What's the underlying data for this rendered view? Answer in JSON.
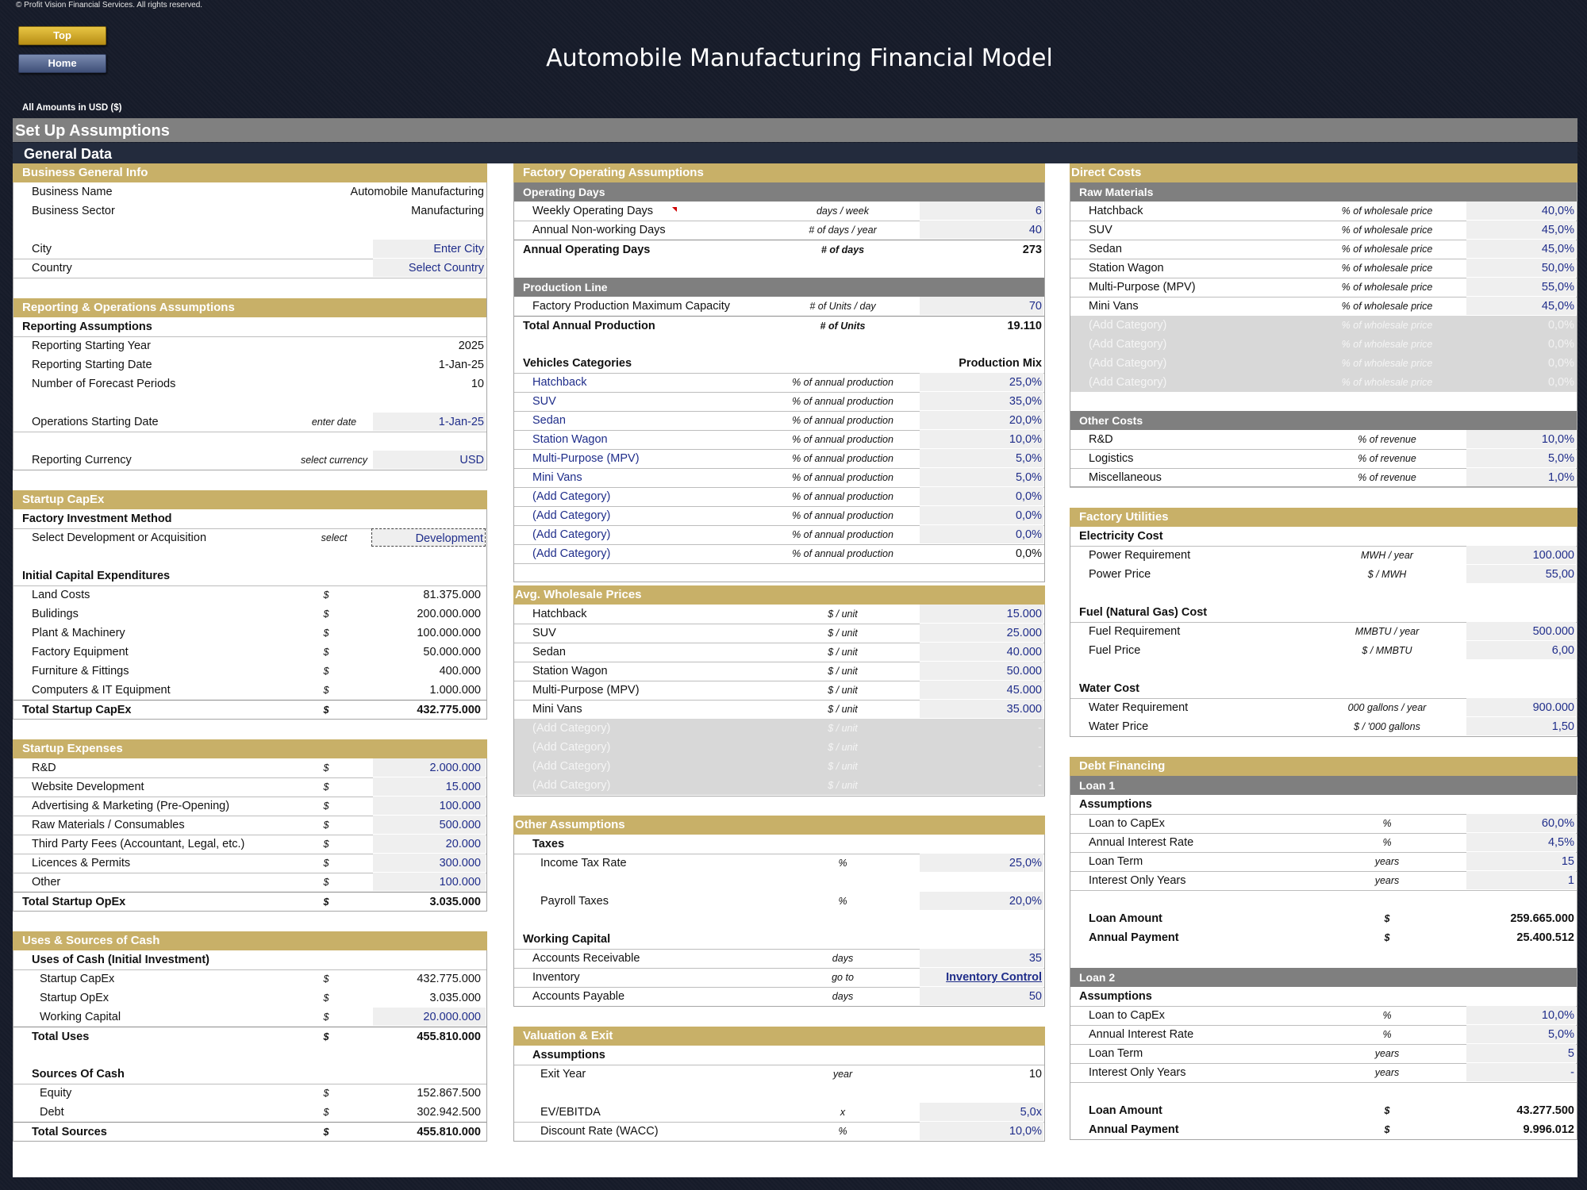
{
  "copyright": "© Profit Vision Financial Services. All rights reserved.",
  "nav": {
    "top": "Top",
    "home": "Home"
  },
  "title": "Automobile Manufacturing Financial Model",
  "amounts_label": "All Amounts in  USD ($)",
  "setup_title": "Set Up Assumptions",
  "general_title": "General Data",
  "colors": {
    "gold": "#c8b068",
    "grey_header": "#7f7f7f",
    "navy": "#232b3d",
    "input_text": "#1f2d8a"
  },
  "col1": {
    "bgi": {
      "title": "Business General Info",
      "business_name_label": "Business Name",
      "business_name": "Automobile Manufacturing",
      "sector_label": "Business Sector",
      "sector": "Manufacturing",
      "city_label": "City",
      "city": "Enter City",
      "country_label": "Country",
      "country": "Select Country"
    },
    "reporting": {
      "title": "Reporting & Operations Assumptions",
      "sub": "Reporting Assumptions",
      "start_year_label": "Reporting Starting Year",
      "start_year": "2025",
      "start_date_label": "Reporting Starting Date",
      "start_date": "1-Jan-25",
      "periods_label": "Number of Forecast Periods",
      "periods": "10",
      "ops_label": "Operations Starting Date",
      "ops_unit": "enter date",
      "ops_date": "1-Jan-25",
      "currency_label": "Reporting Currency",
      "currency_unit": "select currency",
      "currency": "USD"
    },
    "capex": {
      "title": "Startup CapEx",
      "method_sub": "Factory Investment Method",
      "select_label": "Select Development or Acquisition",
      "select_unit": "select",
      "select_value": "Development",
      "initial_sub": "Initial Capital Expenditures",
      "items": [
        {
          "label": "Land Costs",
          "unit": "$",
          "value": "81.375.000"
        },
        {
          "label": "Bulidings",
          "unit": "$",
          "value": "200.000.000"
        },
        {
          "label": "Plant & Machinery",
          "unit": "$",
          "value": "100.000.000"
        },
        {
          "label": "Factory Equipment",
          "unit": "$",
          "value": "50.000.000"
        },
        {
          "label": "Furniture & Fittings",
          "unit": "$",
          "value": "400.000"
        },
        {
          "label": "Computers & IT Equipment",
          "unit": "$",
          "value": "1.000.000"
        }
      ],
      "total_label": "Total Startup CapEx",
      "total_unit": "$",
      "total": "432.775.000"
    },
    "expenses": {
      "title": "Startup Expenses",
      "items": [
        {
          "label": "R&D",
          "unit": "$",
          "value": "2.000.000"
        },
        {
          "label": "Website Development",
          "unit": "$",
          "value": "15.000"
        },
        {
          "label": "Advertising & Marketing (Pre-Opening)",
          "unit": "$",
          "value": "100.000"
        },
        {
          "label": "Raw Materials / Consumables",
          "unit": "$",
          "value": "500.000"
        },
        {
          "label": "Third Party Fees (Accountant, Legal, etc.)",
          "unit": "$",
          "value": "20.000"
        },
        {
          "label": "Licences & Permits",
          "unit": "$",
          "value": "300.000"
        },
        {
          "label": "Other",
          "unit": "$",
          "value": "100.000"
        }
      ],
      "total_label": "Total Startup OpEx",
      "total_unit": "$",
      "total": "3.035.000"
    },
    "uses": {
      "title": "Uses & Sources of Cash",
      "uses_sub": "Uses of Cash (Initial Investment)",
      "uses_items": [
        {
          "label": "Startup CapEx",
          "unit": "$",
          "value": "432.775.000"
        },
        {
          "label": "Startup OpEx",
          "unit": "$",
          "value": "3.035.000"
        },
        {
          "label": "Working Capital",
          "unit": "$",
          "value": "20.000.000"
        }
      ],
      "total_uses_label": "Total Uses",
      "total_uses_unit": "$",
      "total_uses": "455.810.000",
      "sources_sub": "Sources Of Cash",
      "sources_items": [
        {
          "label": "Equity",
          "unit": "$",
          "value": "152.867.500"
        },
        {
          "label": "Debt",
          "unit": "$",
          "value": "302.942.500"
        }
      ],
      "total_sources_label": "Total Sources",
      "total_sources_unit": "$",
      "total_sources": "455.810.000"
    }
  },
  "col2": {
    "factory": {
      "title": "Factory Operating Assumptions",
      "opdays_sub": "Operating Days",
      "weekly_label": "Weekly Operating Days",
      "weekly_unit": "days / week",
      "weekly": "6",
      "nonwork_label": "Annual Non-working Days",
      "nonwork_unit": "# of days / year",
      "nonwork": "40",
      "annual_label": "Annual Operating Days",
      "annual_unit": "# of days",
      "annual": "273",
      "prod_sub": "Production Line",
      "cap_label": "Factory Production Maximum Capacity",
      "cap_unit": "# of Units / day",
      "cap": "70",
      "total_label": "Total Annual Production",
      "total_unit": "# of Units",
      "total": "19.110",
      "veh_label": "Vehicles Categories",
      "mix_label": "Production Mix",
      "veh": [
        {
          "label": "Hatchback",
          "unit": "% of annual production",
          "value": "25,0%"
        },
        {
          "label": "SUV",
          "unit": "% of annual production",
          "value": "35,0%"
        },
        {
          "label": "Sedan",
          "unit": "% of annual production",
          "value": "20,0%"
        },
        {
          "label": "Station Wagon",
          "unit": "% of annual production",
          "value": "10,0%"
        },
        {
          "label": "Multi-Purpose (MPV)",
          "unit": "% of annual production",
          "value": "5,0%"
        },
        {
          "label": "Mini Vans",
          "unit": "% of annual production",
          "value": "5,0%"
        },
        {
          "label": "(Add Category)",
          "unit": "% of annual production",
          "value": "0,0%"
        },
        {
          "label": "(Add Category)",
          "unit": "% of annual production",
          "value": "0,0%"
        },
        {
          "label": "(Add Category)",
          "unit": "% of annual production",
          "value": "0,0%"
        },
        {
          "label": "(Add Category)",
          "unit": "% of annual production",
          "value": "0,0%"
        }
      ]
    },
    "prices": {
      "title": "Avg. Wholesale Prices",
      "items": [
        {
          "label": "Hatchback",
          "unit": "$ / unit",
          "value": "15.000"
        },
        {
          "label": "SUV",
          "unit": "$ / unit",
          "value": "25.000"
        },
        {
          "label": "Sedan",
          "unit": "$ / unit",
          "value": "40.000"
        },
        {
          "label": "Station Wagon",
          "unit": "$ / unit",
          "value": "50.000"
        },
        {
          "label": "Multi-Purpose (MPV)",
          "unit": "$ / unit",
          "value": "45.000"
        },
        {
          "label": "Mini Vans",
          "unit": "$ / unit",
          "value": "35.000"
        }
      ],
      "disabled": [
        {
          "label": "(Add Category)",
          "unit": "$ / unit",
          "value": "-"
        },
        {
          "label": "(Add Category)",
          "unit": "$ / unit",
          "value": "-"
        },
        {
          "label": "(Add Category)",
          "unit": "$ / unit",
          "value": "-"
        },
        {
          "label": "(Add Category)",
          "unit": "$ / unit",
          "value": "-"
        }
      ]
    },
    "other": {
      "title": "Other Assumptions",
      "taxes_sub": "Taxes",
      "income_label": "Income Tax Rate",
      "income_unit": "%",
      "income": "25,0%",
      "payroll_label": "Payroll Taxes",
      "payroll_unit": "%",
      "payroll": "20,0%",
      "wc_sub": "Working Capital",
      "ar_label": "Accounts Receivable",
      "ar_unit": "days",
      "ar": "35",
      "inv_label": "Inventory",
      "inv_unit": "go to",
      "inv": "Inventory Control",
      "ap_label": "Accounts Payable",
      "ap_unit": "days",
      "ap": "50"
    },
    "valuation": {
      "title": "Valuation & Exit",
      "sub": "Assumptions",
      "exit_label": "Exit Year",
      "exit_unit": "year",
      "exit": "10",
      "ev_label": "EV/EBITDA",
      "ev_unit": "x",
      "ev": "5,0x",
      "wacc_label": "Discount Rate (WACC)",
      "wacc_unit": "%",
      "wacc": "10,0%"
    }
  },
  "col3": {
    "direct": {
      "title": "Direct Costs",
      "raw_sub": "Raw Materials",
      "raw": [
        {
          "label": "Hatchback",
          "unit": "% of wholesale price",
          "value": "40,0%"
        },
        {
          "label": "SUV",
          "unit": "% of wholesale price",
          "value": "45,0%"
        },
        {
          "label": "Sedan",
          "unit": "% of wholesale price",
          "value": "45,0%"
        },
        {
          "label": "Station Wagon",
          "unit": "% of wholesale price",
          "value": "50,0%"
        },
        {
          "label": "Multi-Purpose (MPV)",
          "unit": "% of wholesale price",
          "value": "55,0%"
        },
        {
          "label": "Mini Vans",
          "unit": "% of wholesale price",
          "value": "45,0%"
        }
      ],
      "disabled": [
        {
          "label": "(Add Category)",
          "unit": "% of wholesale price",
          "value": "0,0%"
        },
        {
          "label": "(Add Category)",
          "unit": "% of wholesale price",
          "value": "0,0%"
        },
        {
          "label": "(Add Category)",
          "unit": "% of wholesale price",
          "value": "0,0%"
        },
        {
          "label": "(Add Category)",
          "unit": "% of wholesale price",
          "value": "0,0%"
        }
      ],
      "other_sub": "Other Costs",
      "other": [
        {
          "label": "R&D",
          "unit": "% of revenue",
          "value": "10,0%"
        },
        {
          "label": "Logistics",
          "unit": "% of revenue",
          "value": "5,0%"
        },
        {
          "label": "Miscellaneous",
          "unit": "% of revenue",
          "value": "1,0%"
        }
      ]
    },
    "utilities": {
      "title": "Factory Utilities",
      "elec_sub": "Electricity Cost",
      "pr_label": "Power Requirement",
      "pr_unit": "MWH / year",
      "pr": "100.000",
      "pp_label": "Power Price",
      "pp_unit": "$ / MWH",
      "pp": "55,00",
      "fuel_sub": "Fuel (Natural Gas) Cost",
      "fr_label": "Fuel Requirement",
      "fr_unit": "MMBTU / year",
      "fr": "500.000",
      "fp_label": "Fuel Price",
      "fp_unit": "$ / MMBTU",
      "fp": "6,00",
      "water_sub": "Water Cost",
      "wr_label": "Water Requirement",
      "wr_unit": "000 gallons / year",
      "wr": "900.000",
      "wp_label": "Water Price",
      "wp_unit": "$ / '000 gallons",
      "wp": "1,50"
    },
    "debt": {
      "title": "Debt Financing",
      "loan1": {
        "title": "Loan 1",
        "sub": "Assumptions",
        "items": [
          {
            "label": "Loan to CapEx",
            "unit": "%",
            "value": "60,0%"
          },
          {
            "label": "Annual Interest Rate",
            "unit": "%",
            "value": "4,5%"
          },
          {
            "label": "Loan Term",
            "unit": "years",
            "value": "15"
          },
          {
            "label": "Interest Only Years",
            "unit": "years",
            "value": "1"
          }
        ],
        "amount_label": "Loan Amount",
        "amount_unit": "$",
        "amount": "259.665.000",
        "payment_label": "Annual Payment",
        "payment_unit": "$",
        "payment": "25.400.512"
      },
      "loan2": {
        "title": "Loan 2",
        "sub": "Assumptions",
        "items": [
          {
            "label": "Loan to CapEx",
            "unit": "%",
            "value": "10,0%"
          },
          {
            "label": "Annual Interest Rate",
            "unit": "%",
            "value": "5,0%"
          },
          {
            "label": "Loan Term",
            "unit": "years",
            "value": "5"
          },
          {
            "label": "Interest Only Years",
            "unit": "years",
            "value": "-"
          }
        ],
        "amount_label": "Loan Amount",
        "amount_unit": "$",
        "amount": "43.277.500",
        "payment_label": "Annual Payment",
        "payment_unit": "$",
        "payment": "9.996.012"
      }
    }
  }
}
